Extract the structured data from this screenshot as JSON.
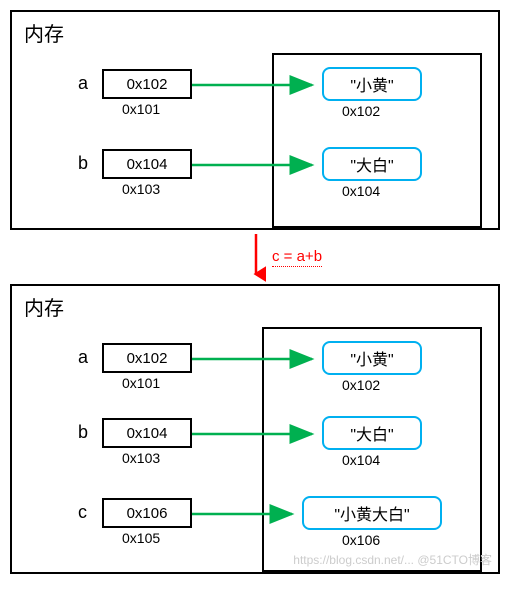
{
  "panel1": {
    "title": "内存",
    "vars": {
      "a": {
        "name": "a",
        "ptr": "0x102",
        "addr": "0x101",
        "value": "\"小黄\"",
        "valAddr": "0x102"
      },
      "b": {
        "name": "b",
        "ptr": "0x104",
        "addr": "0x103",
        "value": "\"大白\"",
        "valAddr": "0x104"
      }
    }
  },
  "transition": {
    "label": "c = a+b"
  },
  "panel2": {
    "title": "内存",
    "vars": {
      "a": {
        "name": "a",
        "ptr": "0x102",
        "addr": "0x101",
        "value": "\"小黄\"",
        "valAddr": "0x102"
      },
      "b": {
        "name": "b",
        "ptr": "0x104",
        "addr": "0x103",
        "value": "\"大白\"",
        "valAddr": "0x104"
      },
      "c": {
        "name": "c",
        "ptr": "0x106",
        "addr": "0x105",
        "value": "\"小黄大白\"",
        "valAddr": "0x106"
      }
    }
  },
  "watermark": "https://blog.csdn.net/... @51CTO博客"
}
